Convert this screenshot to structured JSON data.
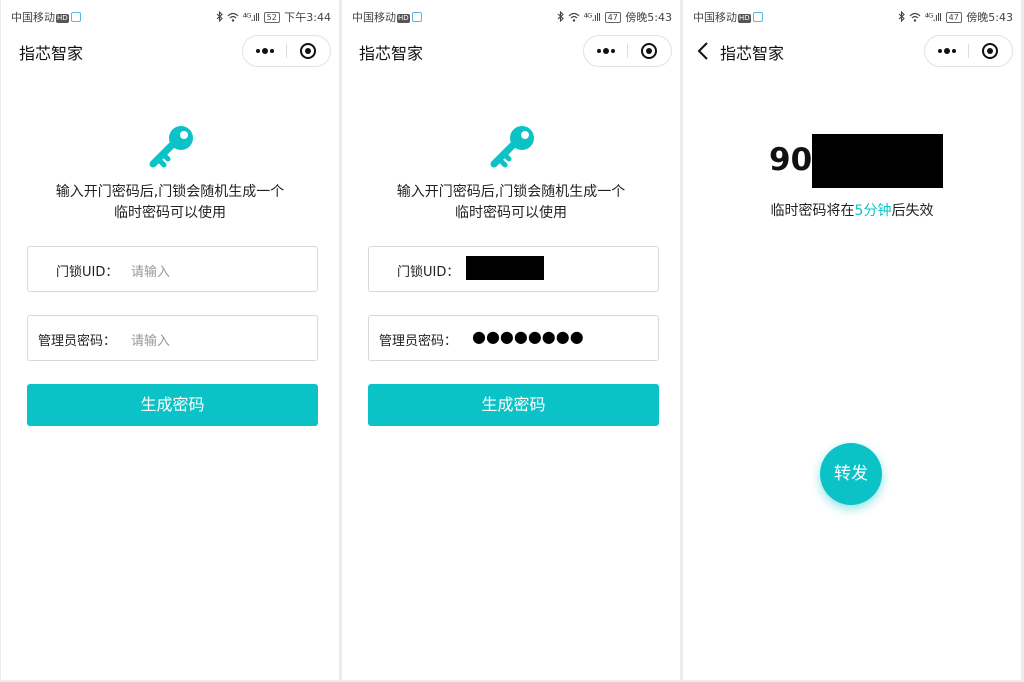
{
  "colors": {
    "accent": "#0bc3c6",
    "field_border": "#d9d9d9",
    "placeholder": "#999999"
  },
  "screens": [
    {
      "status": {
        "carrier": "中国移动",
        "hd": "HD",
        "signal": "⁴ᴳ.ıll",
        "battery": "52",
        "time": "下午3:44"
      },
      "nav": {
        "title": "指芯智家"
      },
      "description": [
        "输入开门密码后,门锁会随机生成一个",
        "临时密码可以使用"
      ],
      "uid_label": "门锁UID：",
      "uid_placeholder": "请输入",
      "admin_label": "管理员密码：",
      "admin_placeholder": "请输入",
      "button": "生成密码",
      "icons": [
        "key-icon",
        "more-dots-icon",
        "mini-program-close-icon",
        "bluetooth-icon",
        "wifi-icon"
      ]
    },
    {
      "status": {
        "carrier": "中国移动",
        "hd": "HD",
        "signal": "⁴ᴳ.ıll",
        "battery": "47",
        "time": "傍晚5:43"
      },
      "nav": {
        "title": "指芯智家"
      },
      "description": [
        "输入开门密码后,门锁会随机生成一个",
        "临时密码可以使用"
      ],
      "uid_label": "门锁UID：",
      "admin_label": "管理员密码：",
      "admin_value": "●●●●●●●●",
      "button": "生成密码"
    },
    {
      "status": {
        "carrier": "中国移动",
        "hd": "HD",
        "signal": "⁴ᴳ.ıll",
        "battery": "47",
        "time": "傍晚5:43"
      },
      "nav": {
        "title": "指芯智家"
      },
      "code_prefix": "90",
      "expire_before": "临时密码将在",
      "expire_highlight": "5分钟",
      "expire_after": "后失效",
      "forward_button": "转发"
    }
  ]
}
